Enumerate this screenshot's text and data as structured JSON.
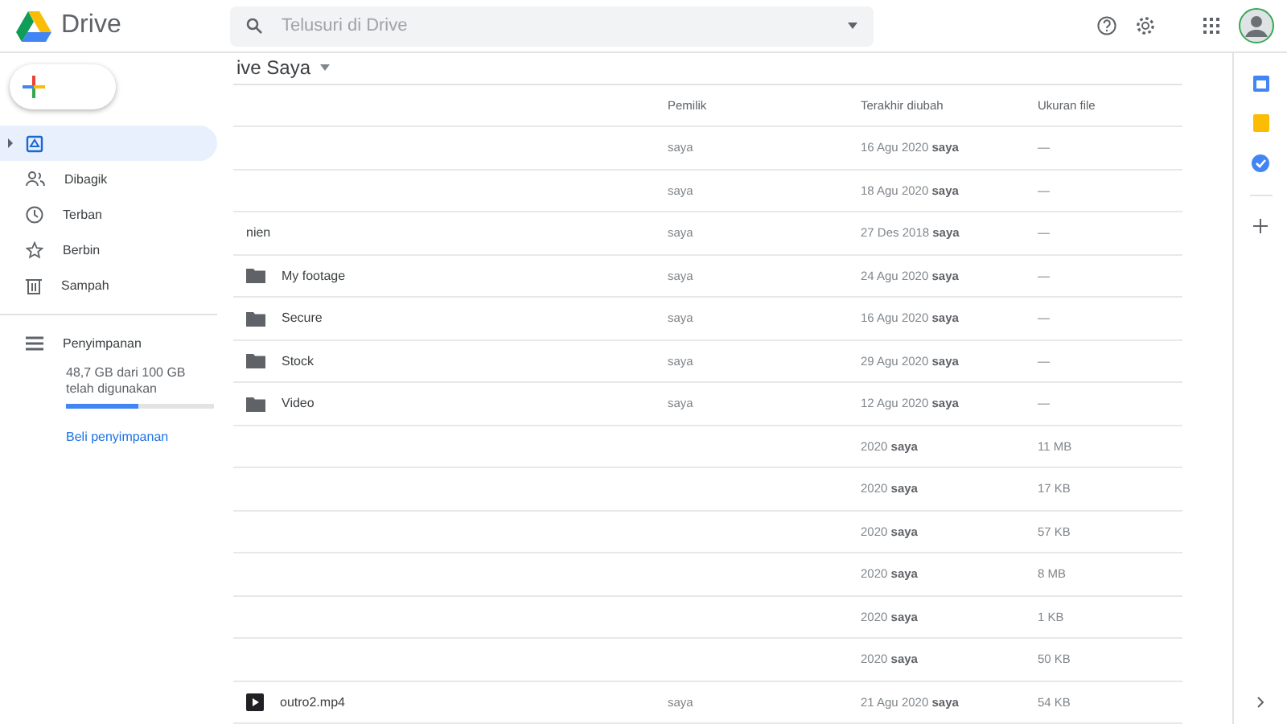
{
  "app": {
    "name": "Drive"
  },
  "search": {
    "placeholder": "Telusuri di Drive"
  },
  "sidebar": {
    "items": [
      {
        "selected": true
      },
      {
        "label": "Dibagik",
        "selected": false
      },
      {
        "label": "Terban",
        "selected": false
      },
      {
        "label": "Berbin",
        "selected": false
      },
      {
        "label": "Sampah",
        "selected": false
      }
    ],
    "storage": {
      "label": "Penyimpanan",
      "usage": "48,7 GB dari 100 GB telah digunakan",
      "level": 0.487,
      "buy_link": "Beli penyimpanan"
    }
  },
  "breadcrumb": "ive Saya",
  "table": {
    "columns": [
      null,
      "Pemilik",
      "Terakhir diubah",
      "Ukuran file"
    ],
    "rows": [
      {
        "kind": "none",
        "owner": "saya",
        "modified": "16 Agu 2020",
        "modified_by": "saya",
        "size": "—"
      },
      {
        "kind": "none",
        "owner": "saya",
        "modified": "18 Agu 2020",
        "modified_by": "saya",
        "size": "—"
      },
      {
        "kind": "none",
        "name": "nien",
        "owner": "saya",
        "modified": "27 Des 2018",
        "modified_by": "saya",
        "size": "—"
      },
      {
        "kind": "folder",
        "name": "My footage",
        "owner": "saya",
        "modified": "24 Agu 2020",
        "modified_by": "saya",
        "size": "—"
      },
      {
        "kind": "folder",
        "name": "Secure",
        "owner": "saya",
        "modified": "16 Agu 2020",
        "modified_by": "saya",
        "size": "—"
      },
      {
        "kind": "folder",
        "name": "Stock",
        "owner": "saya",
        "modified": "29 Agu 2020",
        "modified_by": "saya",
        "size": "—"
      },
      {
        "kind": "folder",
        "name": "Video",
        "owner": "saya",
        "modified": "12 Agu 2020",
        "modified_by": "saya",
        "size": "—"
      },
      {
        "kind": "none",
        "modified": "2020",
        "modified_by": "saya",
        "size": "11 MB"
      },
      {
        "kind": "none",
        "modified": "2020",
        "modified_by": "saya",
        "size": "17 KB"
      },
      {
        "kind": "none",
        "modified": "2020",
        "modified_by": "saya",
        "size": "57 KB"
      },
      {
        "kind": "none",
        "modified": "2020",
        "modified_by": "saya",
        "size": "8 MB"
      },
      {
        "kind": "none",
        "modified": "2020",
        "modified_by": "saya",
        "size": "1 KB"
      },
      {
        "kind": "none",
        "modified": "2020",
        "modified_by": "saya",
        "size": "50 KB"
      },
      {
        "kind": "video",
        "name": "outro2.mp4",
        "owner": "saya",
        "modified": "21 Agu 2020",
        "modified_by": "saya",
        "size": "54 KB"
      }
    ]
  }
}
